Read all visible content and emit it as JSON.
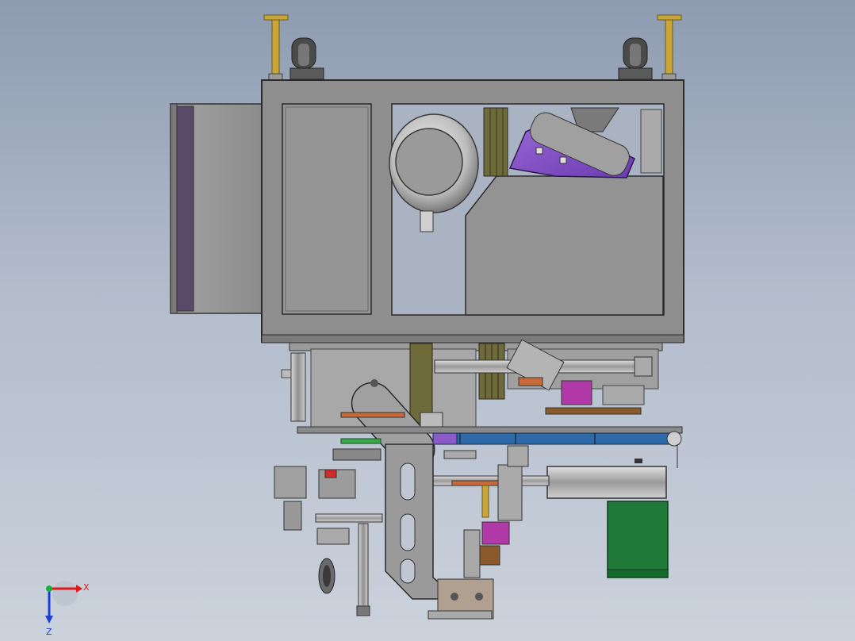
{
  "triad": {
    "x_label": "X",
    "z_label": "Z",
    "x_color": "#e01818",
    "z_color": "#1a3fd0",
    "y_color": "#18b03a"
  },
  "palette": {
    "frame": "#8a8a8a",
    "frame_dark": "#5e5e5e",
    "panel": "#939393",
    "hood_green": "#1f7a3a",
    "motor_purple": "#8a5ac8",
    "brass": "#c9a63a",
    "olive": "#6f6a3a",
    "blue_rail": "#2e6aa8",
    "magenta": "#b23aa8",
    "rust": "#8a5a2a"
  }
}
